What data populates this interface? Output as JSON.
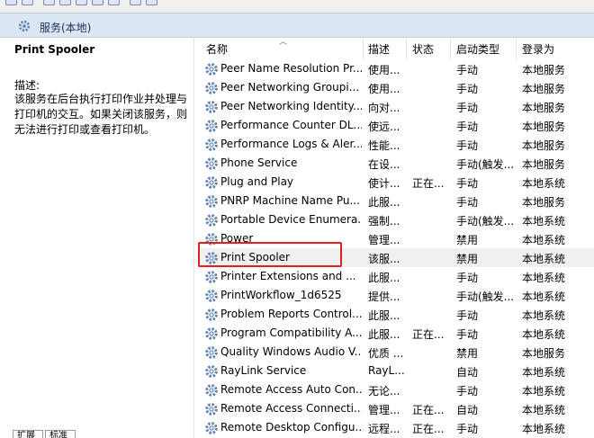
{
  "panel": {
    "title": "服务(本地)"
  },
  "details": {
    "service_name": "Print Spooler",
    "desc_label": "描述:",
    "desc_text": "该服务在后台执行打印作业并处理与打印机的交互。如果关闭该服务，则无法进行打印或查看打印机。"
  },
  "columns": {
    "name": "名称",
    "desc": "描述",
    "status": "状态",
    "startup": "启动类型",
    "logon": "登录为"
  },
  "rows": [
    {
      "name": "Peer Name Resolution Pr...",
      "desc": "使用...",
      "status": "",
      "startup": "手动",
      "logon": "本地服务",
      "selected": false
    },
    {
      "name": "Peer Networking Groupi...",
      "desc": "使用...",
      "status": "",
      "startup": "手动",
      "logon": "本地服务",
      "selected": false
    },
    {
      "name": "Peer Networking Identity...",
      "desc": "向对...",
      "status": "",
      "startup": "手动",
      "logon": "本地服务",
      "selected": false
    },
    {
      "name": "Performance Counter DL...",
      "desc": "使远...",
      "status": "",
      "startup": "手动",
      "logon": "本地服务",
      "selected": false
    },
    {
      "name": "Performance Logs & Aler...",
      "desc": "性能...",
      "status": "",
      "startup": "手动",
      "logon": "本地服务",
      "selected": false
    },
    {
      "name": "Phone Service",
      "desc": "在设...",
      "status": "",
      "startup": "手动(触发...",
      "logon": "本地服务",
      "selected": false
    },
    {
      "name": "Plug and Play",
      "desc": "使计...",
      "status": "正在...",
      "startup": "手动",
      "logon": "本地系统",
      "selected": false
    },
    {
      "name": "PNRP Machine Name Pu...",
      "desc": "此服...",
      "status": "",
      "startup": "手动",
      "logon": "本地服务",
      "selected": false
    },
    {
      "name": "Portable Device Enumera...",
      "desc": "强制...",
      "status": "",
      "startup": "手动(触发...",
      "logon": "本地系统",
      "selected": false
    },
    {
      "name": "Power",
      "desc": "管理...",
      "status": "",
      "startup": "禁用",
      "logon": "本地系统",
      "selected": false
    },
    {
      "name": "Print Spooler",
      "desc": "该服...",
      "status": "",
      "startup": "禁用",
      "logon": "本地系统",
      "selected": true
    },
    {
      "name": "Printer Extensions and ...",
      "desc": "此服...",
      "status": "",
      "startup": "手动",
      "logon": "本地系统",
      "selected": false
    },
    {
      "name": "PrintWorkflow_1d6525",
      "desc": "提供...",
      "status": "",
      "startup": "手动(触发...",
      "logon": "本地系统",
      "selected": false
    },
    {
      "name": "Problem Reports Control...",
      "desc": "此服...",
      "status": "",
      "startup": "手动",
      "logon": "本地系统",
      "selected": false
    },
    {
      "name": "Program Compatibility A...",
      "desc": "此服...",
      "status": "正在...",
      "startup": "手动",
      "logon": "本地系统",
      "selected": false
    },
    {
      "name": "Quality Windows Audio V...",
      "desc": "优质 ...",
      "status": "",
      "startup": "禁用",
      "logon": "本地服务",
      "selected": false
    },
    {
      "name": "RayLink Service",
      "desc": "RayL...",
      "status": "",
      "startup": "自动",
      "logon": "本地系统",
      "selected": false
    },
    {
      "name": "Remote Access Auto Con...",
      "desc": "无论...",
      "status": "",
      "startup": "手动",
      "logon": "本地系统",
      "selected": false
    },
    {
      "name": "Remote Access Connecti...",
      "desc": "管理...",
      "status": "正在...",
      "startup": "自动",
      "logon": "本地系统",
      "selected": false
    },
    {
      "name": "Remote Desktop Configu...",
      "desc": "远程...",
      "status": "正在...",
      "startup": "手动",
      "logon": "本地系统",
      "selected": false
    }
  ],
  "tabs": {
    "extended": "扩展",
    "standard": "标准"
  },
  "colors": {
    "highlight": "#e02020",
    "header_bg": "#dae6f3",
    "gear": "#5a7fb0"
  },
  "icons": {
    "service": "gear-icon"
  }
}
